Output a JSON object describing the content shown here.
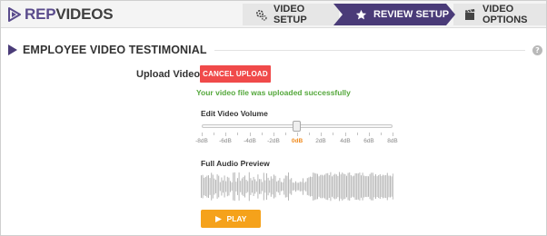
{
  "app": {
    "logo_rep": "REP",
    "logo_videos": "VIDEOS",
    "brand_color": "#5a4b8c"
  },
  "steps": [
    {
      "label": "VIDEO SETUP",
      "icon": "gears-icon",
      "active": false
    },
    {
      "label": "REVIEW SETUP",
      "icon": "star-icon",
      "active": true
    },
    {
      "label": "VIDEO OPTIONS",
      "icon": "film-icon",
      "active": false
    }
  ],
  "section": {
    "title": "EMPLOYEE VIDEO TESTIMONIAL",
    "help_glyph": "?"
  },
  "upload": {
    "label": "Upload Video",
    "cancel_label": "CANCEL UPLOAD",
    "success_message": "Your video file was uploaded successfully",
    "cancel_color": "#f04a4a",
    "success_color": "#55a83c"
  },
  "volume": {
    "label": "Edit Video Volume",
    "ticks": [
      "-8dB",
      "-6dB",
      "-4dB",
      "-2dB",
      "0dB",
      "2dB",
      "4dB",
      "6dB",
      "8dB"
    ],
    "selected_index": 4,
    "min": -8,
    "max": 8,
    "value": 0,
    "active_color": "#f08a1c"
  },
  "audio": {
    "label": "Full Audio Preview",
    "play_label": "PLAY",
    "play_color": "#f5a21b"
  }
}
